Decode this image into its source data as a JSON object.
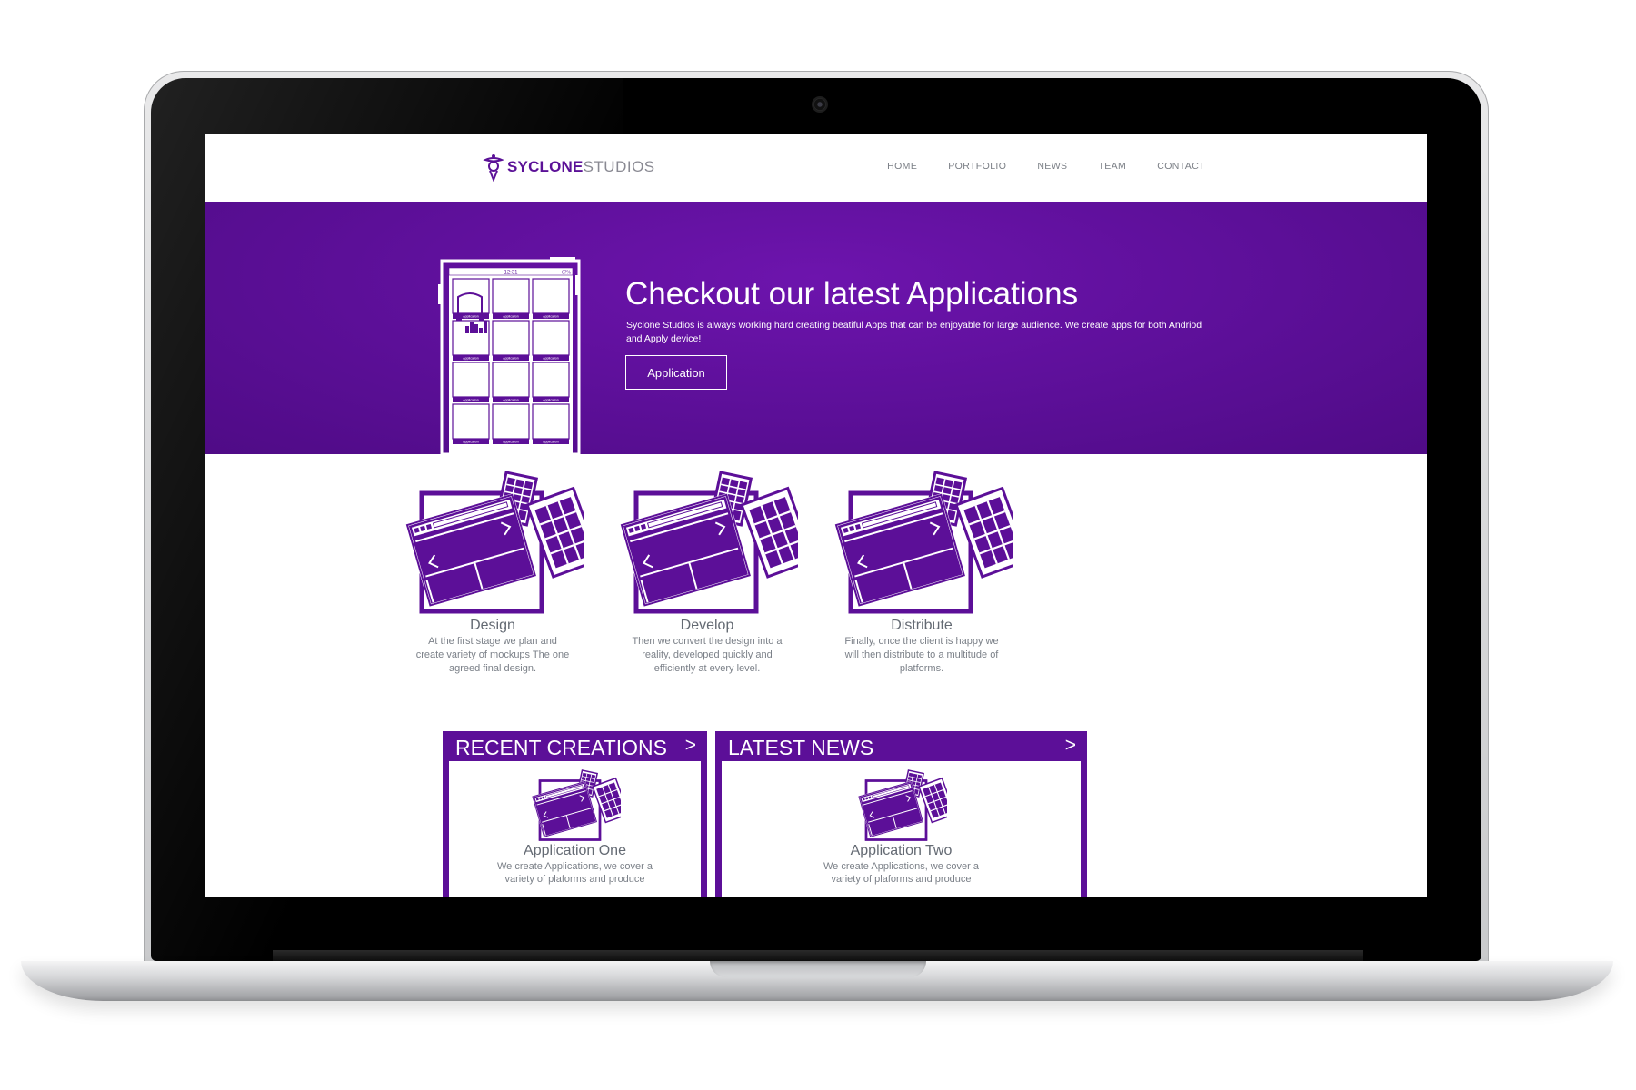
{
  "brand": {
    "name_bold": "SYCLONE",
    "name_light": "STUDIOS",
    "accent": "#5c0f98"
  },
  "nav": {
    "items": [
      "HOME",
      "PORTFOLIO",
      "NEWS",
      "TEAM",
      "CONTACT"
    ]
  },
  "hero": {
    "title": "Checkout our latest Applications",
    "text": "Syclone Studios is always working hard creating beatiful Apps that can be enjoyable for large audience. We create apps for both Andriod and Apply device!",
    "button_label": "Application",
    "phone": {
      "clock": "12:31",
      "battery": "67%",
      "tile_label": "Application"
    }
  },
  "features": [
    {
      "title": "Design",
      "desc": "At the first stage we plan and create variety of mockups The one agreed final design."
    },
    {
      "title": "Develop",
      "desc": "Then we convert the design into a reality, developed quickly and efficiently at every level."
    },
    {
      "title": "Distribute",
      "desc": "Finally, once the client is happy we will then distribute to a multitude of platforms."
    }
  ],
  "panels": {
    "recent": {
      "title": "RECENT CREATIONS",
      "arrow": ">",
      "card_title": "Application One",
      "card_desc": "We create Applications, we cover a variety of plaforms and produce"
    },
    "news": {
      "title": "LATEST NEWS",
      "arrow": ">",
      "card_title": "Application Two",
      "card_desc": "We create Applications, we cover a variety of plaforms and produce"
    }
  }
}
